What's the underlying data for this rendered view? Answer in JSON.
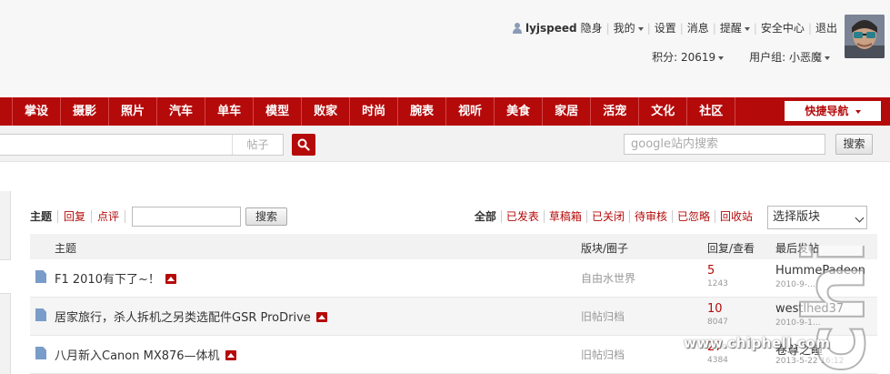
{
  "user": {
    "username": "lyjspeed",
    "links": [
      "隐身",
      "我的",
      "设置",
      "消息",
      "提醒",
      "安全中心",
      "退出"
    ],
    "dropdown_links": [
      "我的",
      "提醒"
    ],
    "points_label": "积分: 20619",
    "group_label": "用户组: 小恶魔"
  },
  "nav": {
    "items": [
      "",
      "掌设",
      "摄影",
      "照片",
      "汽车",
      "单车",
      "模型",
      "败家",
      "时尚",
      "腕表",
      "视听",
      "美食",
      "家居",
      "活宠",
      "文化",
      "社区"
    ],
    "quick_nav": "快捷导航"
  },
  "search": {
    "scope": "帖子",
    "google_placeholder": "google站内搜索",
    "google_button": "搜索"
  },
  "filter": {
    "tabs": [
      "主题",
      "回复",
      "点评"
    ],
    "button": "搜索",
    "status_tabs": [
      "全部",
      "已发表",
      "草稿箱",
      "已关闭",
      "待审核",
      "已忽略",
      "回收站"
    ],
    "forum_select": "选择版块"
  },
  "table": {
    "headers": {
      "title": "主题",
      "forum": "版块/圈子",
      "stats": "回复/查看",
      "last": "最后发帖"
    },
    "rows": [
      {
        "title": "F1 2010有下了~！",
        "forum": "自由水世界",
        "replies": "5",
        "views": "1243",
        "last_user": "HummePadeon",
        "last_date": "2010-9-..."
      },
      {
        "title": "居家旅行，杀人拆机之另类选配件GSR ProDrive",
        "forum": "旧帖归档",
        "replies": "10",
        "views": "8047",
        "last_user": "westlhed37",
        "last_date": "2010-9-1..."
      },
      {
        "title": "八月新入Canon MX876—体机",
        "forum": "旧帖归档",
        "replies": "27",
        "views": "4384",
        "last_user": "卷尊之瞳",
        "last_date": "2013-5-22 16:12"
      }
    ]
  },
  "watermark": {
    "text": "chip",
    "url": "www.chiphell.com"
  },
  "colors": {
    "brand_red": "#b50a0a",
    "nav_text": "#ffffff",
    "link_red": "#b50a0a",
    "muted": "#999999"
  },
  "icons": {
    "user": "person-icon",
    "search": "magnifier-icon",
    "doc": "document-icon",
    "image": "image-icon"
  }
}
